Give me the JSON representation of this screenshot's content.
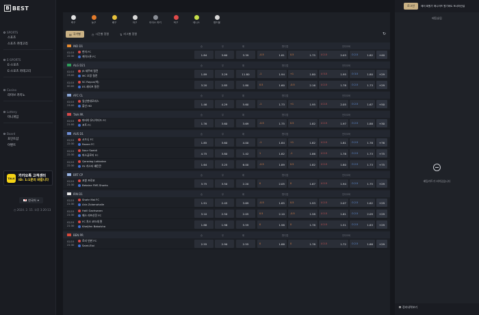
{
  "brand": {
    "logo_letter": "B",
    "name": "BEST"
  },
  "sidebar": {
    "sections": [
      {
        "head": "SPORTS",
        "items": [
          "스포츠",
          "스포츠 카테고리"
        ]
      },
      {
        "head": "E-SPORTS",
        "items": [
          "E-스포츠",
          "E-스포츠 카테고리"
        ]
      },
      {
        "head": "Casino",
        "items": [
          "라이브 카지노"
        ]
      },
      {
        "head": "Lottery",
        "items": [
          "미니게임"
        ]
      },
      {
        "head": "Board",
        "items": [
          "포인트샵",
          "이벤트"
        ]
      }
    ],
    "kakao": {
      "icon_text": "TALK",
      "title": "카카오톡 고객센터",
      "subtitle": "ID: 1:1문의 바랍니다"
    },
    "language": "한국어",
    "datetime": "2024. 2. 15. 오후 3:20:13"
  },
  "sport_tabs": [
    {
      "label": "축구",
      "color": "#e0e0e0"
    },
    {
      "label": "농구",
      "color": "#e37b2b"
    },
    {
      "label": "배구",
      "color": "#e8c23b"
    },
    {
      "label": "야구",
      "color": "#d8d8d8"
    },
    {
      "label": "아이스 하키",
      "color": "#8a8e96"
    },
    {
      "label": "탁구",
      "color": "#e04a4a"
    },
    {
      "label": "테니스",
      "color": "#c7e04a"
    },
    {
      "label": "핸드볼",
      "color": "#d8d8d8"
    }
  ],
  "filters": {
    "active": "국가별",
    "f2": "시간별 정렬",
    "f3": "리그별 정렬"
  },
  "col_headers": {
    "home": "승",
    "draw": "무",
    "away": "패",
    "handicap": "핸디캡",
    "ou": "언더오버"
  },
  "leagues": [
    {
      "name": "IND D1",
      "flag": "#e68a2e",
      "matches": [
        {
          "date": "02/15",
          "time": "22:30",
          "home": "펀자 FC",
          "away": "케이스톤 FC",
          "odds": [
            "1.84",
            "3.60",
            "3.39"
          ],
          "hcp": [
            "-0.5",
            "1.81",
            "0.5",
            "1.75"
          ],
          "ou": [
            "U 2.5",
            "2.03",
            "O 2.5",
            "1.82"
          ],
          "more": "+40"
        }
      ]
    },
    {
      "name": "ALG D21",
      "flag": "#2e9e5a",
      "matches": [
        {
          "date": "02/15",
          "time": "23:00",
          "home": "JS 세주바 질전",
          "away": "MC 오랑 질전",
          "odds": [
            "1.89",
            "3.29",
            "11.80"
          ],
          "hcp": [
            "-1",
            "1.94",
            "+1",
            "1.80"
          ],
          "ou": [
            "U 3.5",
            "1.95",
            "O 3.5",
            "1.80"
          ],
          "more": "+29"
        },
        {
          "date": "02/15",
          "time": "00:00",
          "home": "SC Rayon(따)",
          "away": "ES 세티프 질전",
          "odds": [
            "3.20",
            "2.85",
            "1.80"
          ],
          "hcp": [
            "0.5",
            "1.60",
            "-0.5",
            "2.16"
          ],
          "ou": [
            "U 2.5",
            "1.78",
            "O 2.5",
            "1.73"
          ],
          "more": "+29"
        }
      ]
    },
    {
      "name": "AFC CL",
      "flag": "#8aa6d6",
      "matches": [
        {
          "date": "02/15",
          "time": "23:00",
          "home": "일산현대모비스",
          "away": "울산 HD",
          "odds": [
            "1.46",
            "4.29",
            "5.60"
          ],
          "hcp": [
            "-1",
            "1.73",
            "+1",
            "1.95"
          ],
          "ou": [
            "U 2.5",
            "2.05",
            "O 2.5",
            "1.67"
          ],
          "more": "+50"
        }
      ]
    },
    {
      "name": "THA PR",
      "flag": "#d84a4a",
      "matches": [
        {
          "date": "02/15",
          "time": "21:00",
          "home": "파타야 유나이티드 FC",
          "away": "포트 FC",
          "odds": [
            "1.76",
            "3.60",
            "3.69"
          ],
          "hcp": [
            "-0.5",
            "1.75",
            "0.5",
            "1.82"
          ],
          "ou": [
            "U 2.5",
            "1.97",
            "O 2.5",
            "1.88"
          ],
          "more": "+30"
        }
      ]
    },
    {
      "name": "AUS D1",
      "flag": "#6f8fd6",
      "matches": [
        {
          "date": "02/15",
          "time": "22:30",
          "home": "시드니 FC",
          "away": "Raven FC",
          "odds": [
            "1.85",
            "3.60",
            "4.00"
          ],
          "hcp": [
            "-1",
            "1.84",
            "+1",
            "1.82"
          ],
          "ou": [
            "U 2.5",
            "1.81",
            "O 2.5",
            "1.78"
          ],
          "more": "+76"
        },
        {
          "date": "02/15",
          "time": "22:30",
          "home": "Nour Saeidi",
          "away": "퍼스글로리 FC",
          "odds": [
            "4.75",
            "3.80",
            "1.42"
          ],
          "hcp": [
            "1",
            "1.82",
            "-1",
            "1.86"
          ],
          "ou": [
            "U 2.5",
            "1.78",
            "O 2.5",
            "1.73"
          ],
          "more": "+75"
        },
        {
          "date": "02/15",
          "time": "22:30",
          "home": "Qaradag Lokbatan",
          "away": "FK 카스터 배탄콘",
          "odds": [
            "1.64",
            "3.25",
            "6.00"
          ],
          "hcp": [
            "-0.5",
            "1.89",
            "0.5",
            "1.82"
          ],
          "ou": [
            "U 2.5",
            "1.80",
            "O 2.5",
            "1.73"
          ],
          "more": "+75"
        }
      ]
    },
    {
      "name": "BRT CP",
      "flag": "#9ab6e6",
      "matches": [
        {
          "date": "02/15",
          "time": "21:30",
          "home": "포항 프로코",
          "away": "Betaine FMS Sharks",
          "odds": [
            "3.75",
            "3.50",
            "2.20"
          ],
          "hcp": [
            "0",
            "2.05",
            "0",
            "1.67"
          ],
          "ou": [
            "U 2.5",
            "1.94",
            "O 2.5",
            "1.75"
          ],
          "more": "+29"
        }
      ]
    },
    {
      "name": "IRN D1",
      "flag": "#e8e8e8",
      "matches": [
        {
          "date": "02/15",
          "time": "21:30",
          "home": "Shohr Mal FC",
          "away": "Aria Zolamahalle",
          "odds": [
            "1.91",
            "2.45",
            "3.69"
          ],
          "hcp": [
            "-0.5",
            "1.85",
            "0.5",
            "1.93"
          ],
          "ou": [
            "U 2.5",
            "2.07",
            "O 2.5",
            "1.62"
          ],
          "more": "+29"
        },
        {
          "date": "02/15",
          "time": "21:30",
          "home": "Halil Gachsaran",
          "away": "메스 라프산잔 FC",
          "odds": [
            "3.10",
            "2.50",
            "2.05"
          ],
          "hcp": [
            "0.5",
            "2.10",
            "-0.5",
            "1.58"
          ],
          "ou": [
            "U 2.5",
            "1.61",
            "O 2.5",
            "2.09"
          ],
          "more": "+29"
        },
        {
          "date": "02/15",
          "time": "21:30",
          "home": "FC 치스 코드레 퀸",
          "away": "Kheijfen Babolsha",
          "odds": [
            "1.88",
            "1.96",
            "5.59"
          ],
          "hcp": [
            "0",
            "1.98",
            "0",
            "1.78"
          ],
          "ou": [
            "U 2.5",
            "1.51",
            "O 2.5",
            "1.83"
          ],
          "more": "+29"
        }
      ]
    },
    {
      "name": "BEN PR",
      "flag": "#d6493a",
      "matches": [
        {
          "date": "02/15",
          "time": "21:30",
          "home": "로리 빈판 FC",
          "away": "Saint-Eloi",
          "odds": [
            "2.55",
            "2.90",
            "2.55"
          ],
          "hcp": [
            "0",
            "1.88",
            "0",
            "1.78"
          ],
          "ou": [
            "U 2.5",
            "1.72",
            "O 2.5",
            "1.88"
          ],
          "more": "+29"
        }
      ]
    }
  ],
  "right_panel": {
    "top_button": "로그인",
    "top_links": "에러 회원가 애니러프 원기버트 토너머컨설",
    "slip_title": "베팅슬립",
    "slip_empty": "베팅카트가 비어있습니다",
    "my_bets": "정리내역보기"
  }
}
